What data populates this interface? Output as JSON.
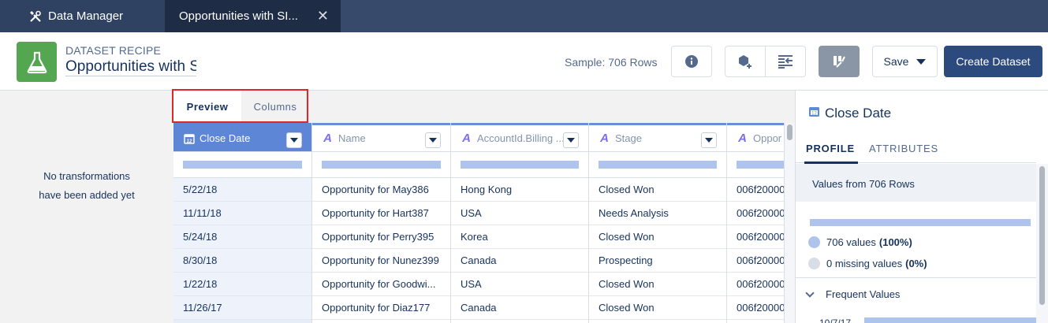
{
  "tabs": {
    "app_label": "Data Manager",
    "active_label": "Opportunities with SI..."
  },
  "header": {
    "kind": "DATASET RECIPE",
    "name": "Opportunities with S",
    "sample": "Sample: 706 Rows",
    "save_label": "Save",
    "create_label": "Create Dataset"
  },
  "left_panel": {
    "line1": "No transformations",
    "line2": "have been added yet"
  },
  "preview_tabs": {
    "preview": "Preview",
    "columns": "Columns"
  },
  "table": {
    "columns": [
      {
        "label": "Close Date",
        "type": "date"
      },
      {
        "label": "Name",
        "type": "text"
      },
      {
        "label": "AccountId.Billing ...",
        "type": "text"
      },
      {
        "label": "Stage",
        "type": "text"
      },
      {
        "label": "Oppor",
        "type": "text"
      }
    ],
    "rows": [
      [
        "5/22/18",
        "Opportunity for May386",
        "Hong Kong",
        "Closed Won",
        "006f20000"
      ],
      [
        "11/11/18",
        "Opportunity for Hart387",
        "USA",
        "Needs Analysis",
        "006f20000"
      ],
      [
        "5/24/18",
        "Opportunity for Perry395",
        "Korea",
        "Closed Won",
        "006f20000"
      ],
      [
        "8/30/18",
        "Opportunity for Nunez399",
        "Canada",
        "Prospecting",
        "006f20000"
      ],
      [
        "1/22/18",
        "Opportunity for Goodwi...",
        "USA",
        "Closed Won",
        "006f20000"
      ],
      [
        "11/26/17",
        "Opportunity for Diaz177",
        "Canada",
        "Closed Won",
        "006f20000"
      ]
    ]
  },
  "right_panel": {
    "title": "Close Date",
    "tab_profile": "PROFILE",
    "tab_attributes": "ATTRIBUTES",
    "values_from": "Values from 706 Rows",
    "values_count": "706 values",
    "values_pct": "(100%)",
    "missing_count": "0 missing values",
    "missing_pct": "(0%)",
    "frequent_label": "Frequent Values",
    "frequent_first": "10/7/17",
    "values_fraction": 1.0,
    "colors": {
      "present": "#aec4ec",
      "missing": "#d8dde6"
    }
  }
}
